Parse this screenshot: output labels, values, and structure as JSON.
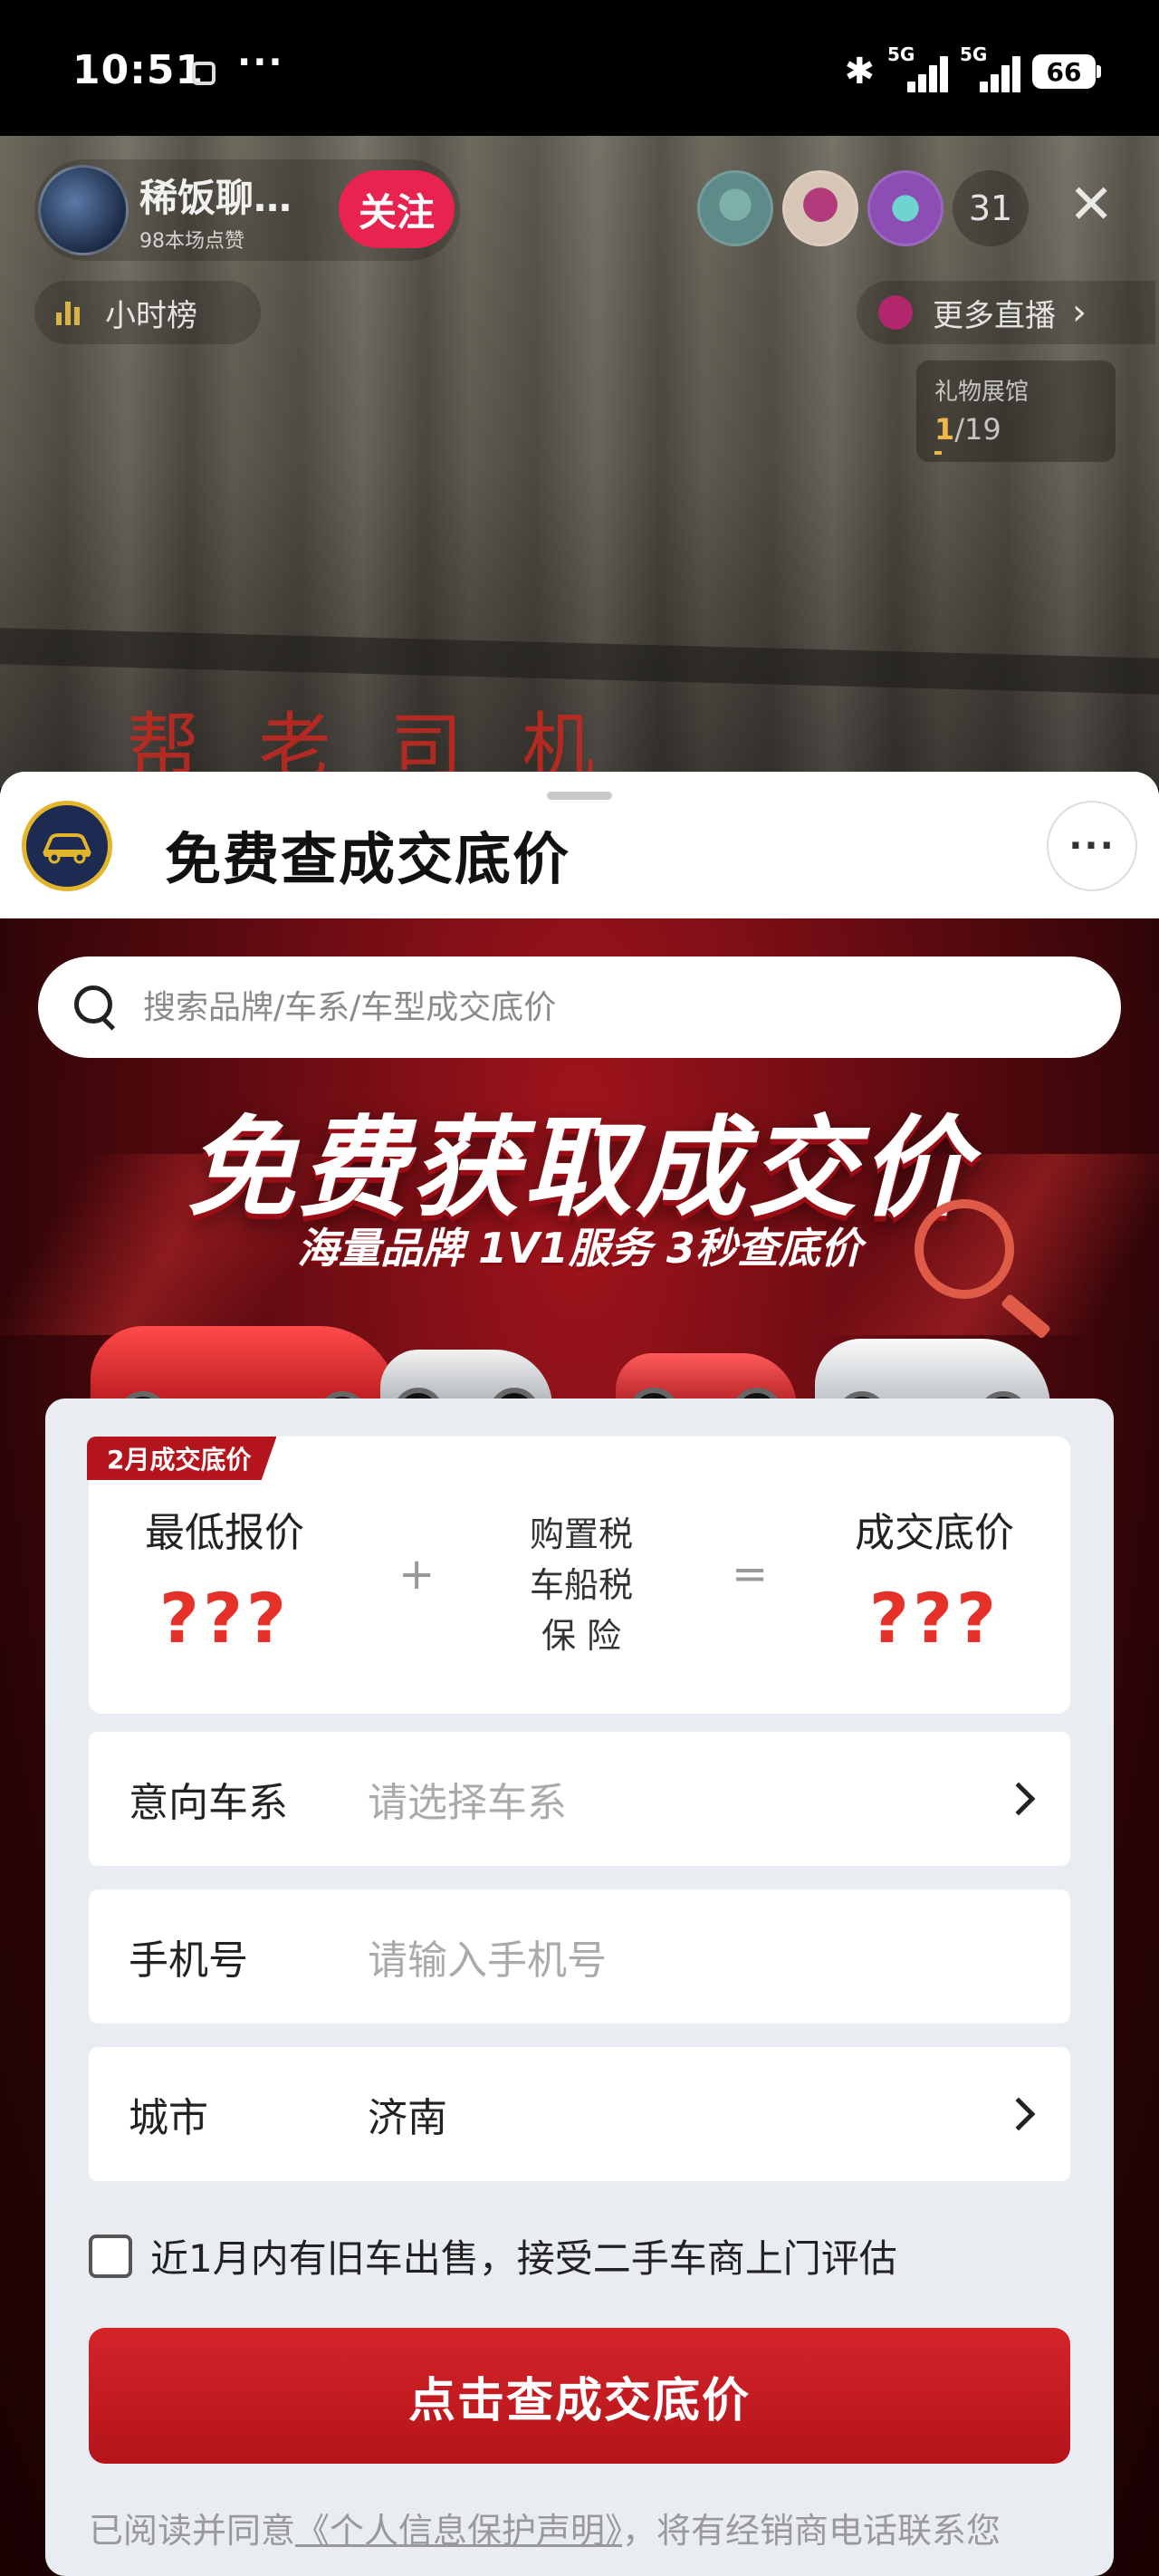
{
  "status_bar": {
    "time": "10:51",
    "more": "···",
    "signal1": "5G",
    "signal2": "5G",
    "battery": "66"
  },
  "live": {
    "host_name": "稀饭聊…",
    "host_likes": "98本场点赞",
    "follow_label": "关注",
    "viewer_count": "31",
    "close_label": "✕",
    "hour_rank": "小时榜",
    "more_live": "更多直播",
    "gift_hall": {
      "title": "礼物展馆",
      "current": "1",
      "total": "/19"
    }
  },
  "sheet": {
    "title": "免费查成交底价",
    "more": "···",
    "search_placeholder": "搜索品牌/车系/车型成交底价",
    "banner_title": "免费获取成交价",
    "banner_sub": "海量品牌 1V1服务 3秒查底价",
    "price": {
      "tag": "2月成交底价",
      "lowest_label": "最低报价",
      "lowest_value": "???",
      "plus": "+",
      "fees": [
        "购置税",
        "车船税",
        "保 险"
      ],
      "equals": "=",
      "final_label": "成交底价",
      "final_value": "???"
    },
    "fields": {
      "series_label": "意向车系",
      "series_placeholder": "请选择车系",
      "phone_label": "手机号",
      "phone_placeholder": "请输入手机号",
      "city_label": "城市",
      "city_value": "济南"
    },
    "checkbox_label": "近1月内有旧车出售，接受二手车商上门评估",
    "submit_label": "点击查成交底价",
    "agree_prefix": "已阅读并同意",
    "agree_link": "《个人信息保护声明》",
    "agree_suffix": "，将有经销商电话联系您"
  }
}
